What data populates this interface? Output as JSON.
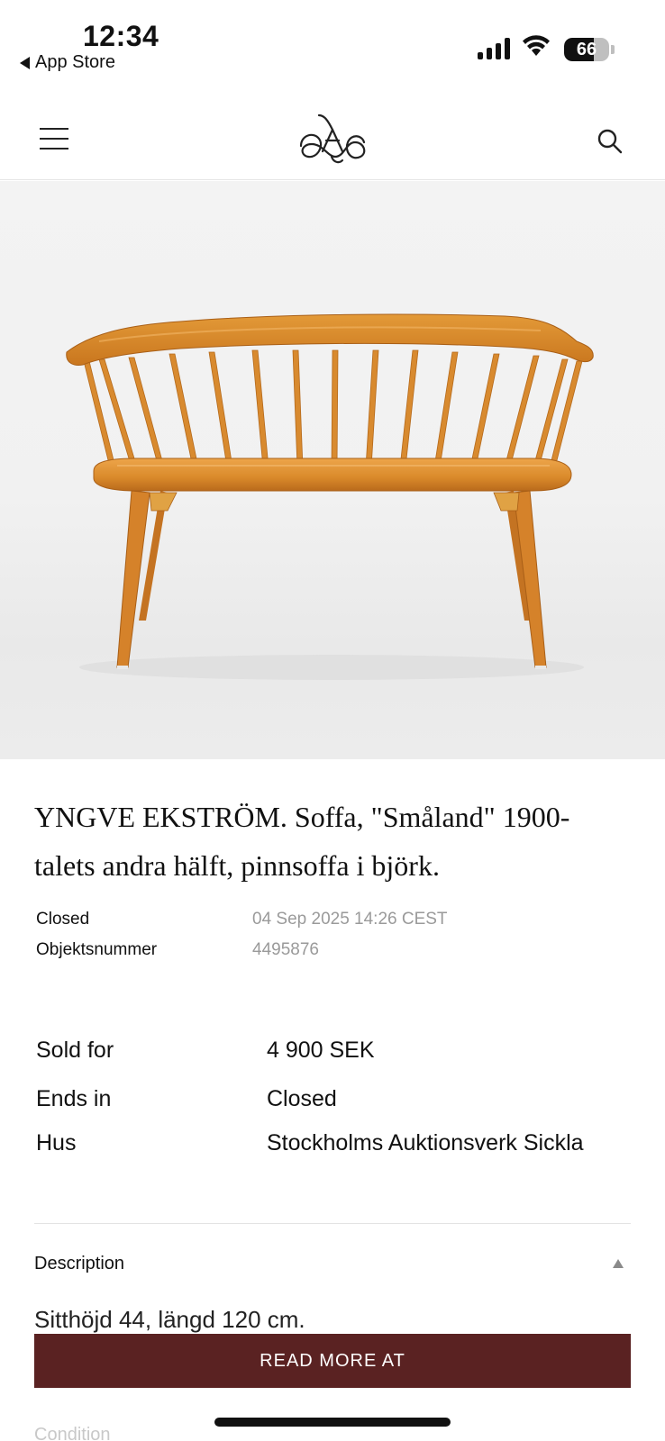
{
  "status_bar": {
    "time": "12:34",
    "back_label": "App Store",
    "battery_percent": 66,
    "battery_text": "66"
  },
  "header": {
    "menu_icon": "hamburger-menu-icon",
    "logo_icon": "auction-house-monogram-logo",
    "search_icon": "search-icon"
  },
  "product": {
    "image_alt": "Wooden spindle-back sofa bench in birch",
    "title": "YNGVE EKSTRÖM. Soffa, \"Småland\" 1900-talets andra hälft, pinnsoffa i björk.",
    "meta": [
      {
        "label": "Closed",
        "value": "04 Sep 2025 14:26 CEST"
      },
      {
        "label": "Objektsnummer",
        "value": "4495876"
      }
    ],
    "sale": {
      "sold_for_label": "Sold for",
      "sold_for_value": "4 900 SEK",
      "ends_in_label": "Ends in",
      "ends_in_value": "Closed",
      "house_label": "Hus",
      "house_value": "Stockholms Auktionsverk Sickla"
    }
  },
  "description": {
    "label": "Description",
    "text": "Sitthöjd 44, längd 120 cm.",
    "read_more_label": "READ MORE AT"
  },
  "footer": {
    "partial_label": "Condition"
  },
  "colors": {
    "accent_button": "#5a2222",
    "muted_text": "#9a9a9a",
    "wood": "#d98b2b"
  }
}
